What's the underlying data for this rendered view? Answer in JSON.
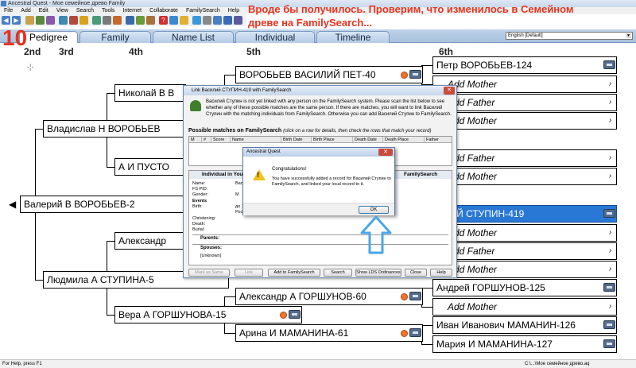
{
  "window": {
    "title": "Ancestral Quest - Мое семейное древо Family"
  },
  "menu": [
    "File",
    "Add",
    "Edit",
    "View",
    "Search",
    "Tools",
    "Internet",
    "Collaborate",
    "FamilySearch",
    "Help"
  ],
  "overlay": {
    "note": "Вроде бы получилось. Проверим, что изменилось в Семейном древе на FamilySearch...",
    "step_number": "10"
  },
  "tabs": [
    "Pedigree",
    "Family",
    "Name List",
    "Individual",
    "Timeline"
  ],
  "active_tab": "Pedigree",
  "language": "English [Default]",
  "generations": [
    "2nd",
    "3rd",
    "4th",
    "5th",
    "6th"
  ],
  "pedigree": {
    "root": "Валерий В ВОРОБЬЕВ-2",
    "father": "Владислав Н ВОРОБЬЕВ",
    "mother": "Людмила А СТУПИНА-5",
    "ff": "Николай В В",
    "fm": "А И ПУСТО",
    "mf": "Александр",
    "mm": "Вера А ГОРШУНОВА-15",
    "fff": "ВОРОБЬЕВ ВАСИЛИЙ ПЕТ-40",
    "mmf": "Александр А ГОРШУНОВ-60",
    "mmm": "Арина И МАМАНИНА-61",
    "g6": [
      "Петр ВОРОБЬЕВ-124",
      "Add Mother",
      "Add Father",
      "Add Mother",
      "Add Father",
      "Add Mother",
      "ИЛИЙ СТУПИН-419",
      "Add Mother",
      "Add Father",
      "Add Mother",
      "Андрей ГОРШУНОВ-125",
      "Add Mother",
      "Иван Иванович МАМАНИН-126",
      "Мария И МАМАНИНА-127"
    ]
  },
  "link_dialog": {
    "title": "Link Василий СТУПИН-419 with FamilySearch",
    "message": "Василий Ступин is not yet linked with any person on the FamilySearch system. Please scan the list below to see whether any of these possible matches are the same person. If there are matches, you will want to link Василий Ступин with the matching individuals from FamilySearch. Otherwise you can add Василий Ступин to FamilySearch.",
    "matches_heading": "Possible matches on FamilySearch",
    "matches_note": "(click on a row for details, then check the rows that match your record)",
    "columns": [
      "M",
      "#",
      "Score",
      "Name",
      "Birth Date",
      "Birth Place",
      "Death Date",
      "Death Place",
      "Father"
    ],
    "individual_heading": "Individual in Your L",
    "individual_right": "FamilySearch",
    "fields": [
      {
        "label": "Name:",
        "value": "Васил"
      },
      {
        "label": "FS PID:",
        "value": ""
      },
      {
        "label": "Gender:",
        "value": "M"
      },
      {
        "label": "Events",
        "value": ""
      },
      {
        "label": "Birth:",
        "value": "до 18"
      },
      {
        "label": "",
        "value": "Росси"
      },
      {
        "label": "Christening:",
        "value": ""
      },
      {
        "label": "Death:",
        "value": ""
      },
      {
        "label": "Burial:",
        "value": ""
      }
    ],
    "parents_label": "Parents:",
    "spouses_label": "Spouses:",
    "unknown_spouse": "[Unknown]",
    "buttons": [
      "Mark as Same",
      "Link",
      "Add to FamilySearch",
      "Search",
      "Show LDS Ordinances",
      "Close",
      "Help"
    ]
  },
  "modal": {
    "title": "Ancestral Quest",
    "heading": "Congratulations!",
    "message": "You have successfully added a record for Василий Ступин to FamilySearch, and linked your local record to it.",
    "ok": "OK"
  },
  "status": {
    "left": "For Help, press F1",
    "right": "C:\\...\\Мое семейное древо.aq"
  },
  "colors": {
    "selected": "#2a78d6",
    "annotation": "#e8321e",
    "callout": "#4aa7e6"
  }
}
